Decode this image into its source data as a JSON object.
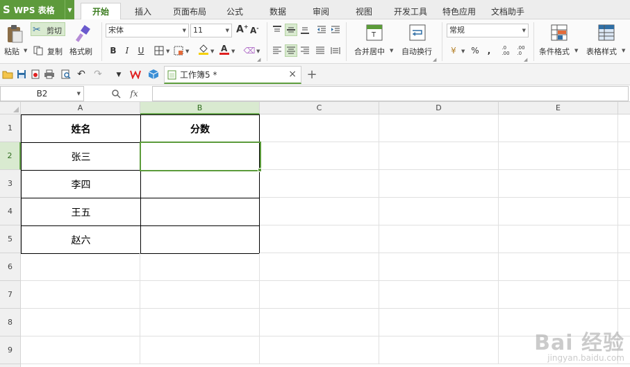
{
  "app": {
    "logo": "S",
    "name": "WPS 表格"
  },
  "menu_tabs": [
    "开始",
    "插入",
    "页面布局",
    "公式",
    "数据",
    "审阅",
    "视图",
    "开发工具",
    "特色应用",
    "文档助手"
  ],
  "active_tab": "开始",
  "ribbon": {
    "paste_label": "粘贴",
    "cut_label": "剪切",
    "copy_label": "复制",
    "format_painter_label": "格式刷",
    "font_name": "宋体",
    "font_size": "11",
    "bold": "B",
    "italic": "I",
    "underline": "U",
    "merge_center_label": "合并居中",
    "wrap_text_label": "自动换行",
    "number_format": "常规",
    "percent": "%",
    "thousands": ",",
    "increase_decimal": ".0\n.00",
    "decrease_decimal": ".00\n.0",
    "conditional_format_label": "条件格式",
    "table_style_label": "表格样式"
  },
  "document": {
    "tab_title": "工作簿5 *",
    "close": "×",
    "new_tab": "+"
  },
  "formula_bar": {
    "name_box": "B2",
    "fx": "fx",
    "formula": ""
  },
  "sheet": {
    "columns": [
      "A",
      "B",
      "C",
      "D",
      "E"
    ],
    "rows": [
      "1",
      "2",
      "3",
      "4",
      "5",
      "6",
      "7",
      "8",
      "9"
    ],
    "selected_cell": "B2",
    "cells": {
      "A1": "姓名",
      "B1": "分数",
      "A2": "张三",
      "A3": "李四",
      "A4": "王五",
      "A5": "赵六"
    }
  },
  "watermark": {
    "main": "Bai 经验",
    "sub": "jingyan.baidu.com"
  },
  "colors": {
    "accent": "#5d9a3b",
    "selection": "#5b9b3a"
  }
}
